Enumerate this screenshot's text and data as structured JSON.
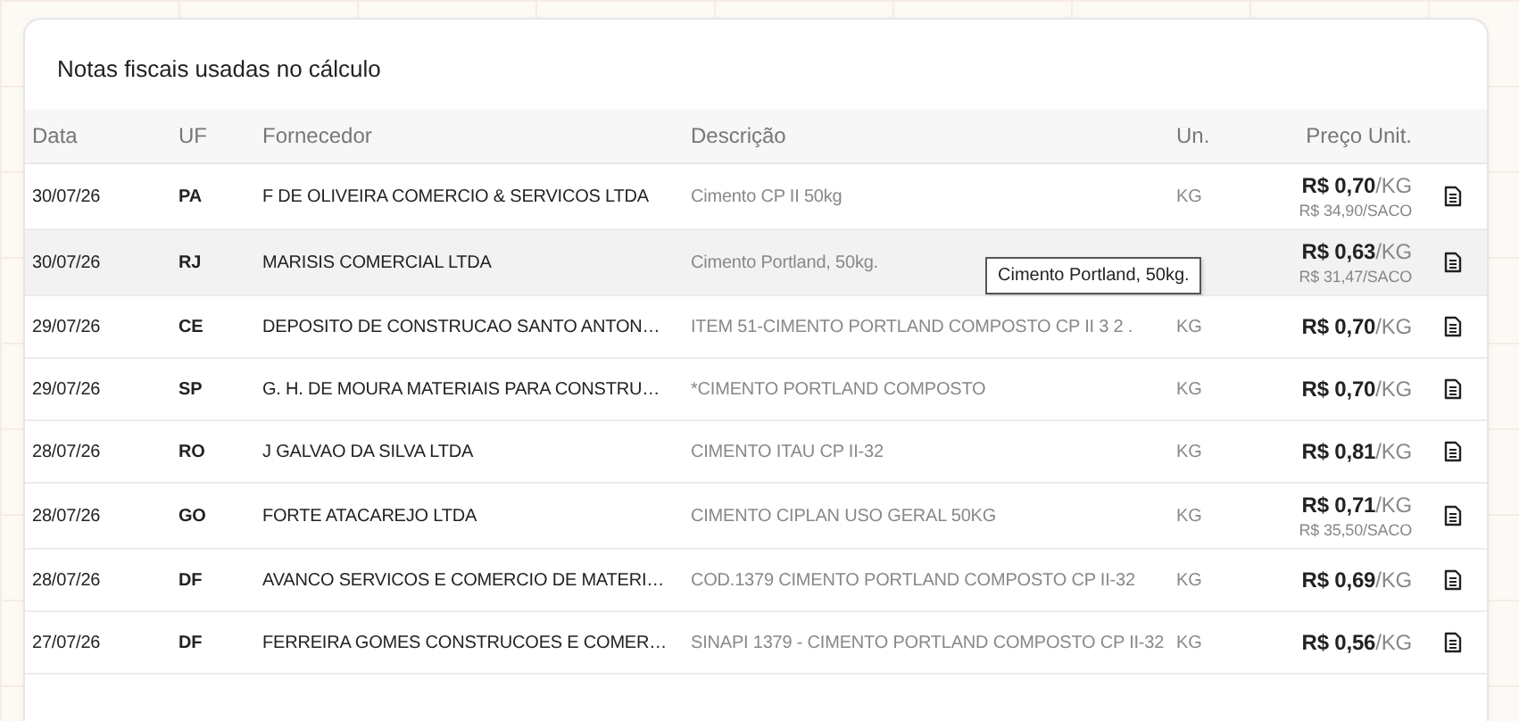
{
  "card": {
    "title": "Notas fiscais usadas no cálculo"
  },
  "table": {
    "columns": [
      "Data",
      "UF",
      "Fornecedor",
      "Descrição",
      "Un.",
      "Preço Unit."
    ],
    "rows": [
      {
        "date": "30/07/26",
        "uf": "PA",
        "supplier": "F DE OLIVEIRA COMERCIO & SERVICOS LTDA",
        "description": "Cimento CP II 50kg",
        "unit": "KG",
        "price": "**R$ 0,70**/KG",
        "price_alt": "R$ 34,90/SACO",
        "hovered": false
      },
      {
        "date": "30/07/26",
        "uf": "RJ",
        "supplier": "MARISIS COMERCIAL LTDA",
        "description": "Cimento Portland, 50kg.",
        "unit": "",
        "price": "**R$ 0,63**/KG",
        "price_alt": "R$ 31,47/SACO",
        "hovered": true,
        "tooltip": "Cimento Portland, 50kg."
      },
      {
        "date": "29/07/26",
        "uf": "CE",
        "supplier": "DEPOSITO DE CONSTRUCAO SANTO ANTON…",
        "description": "ITEM 51-CIMENTO PORTLAND COMPOSTO CP II 3 2 .",
        "unit": "KG",
        "price": "**R$ 0,70**/KG",
        "hovered": false
      },
      {
        "date": "29/07/26",
        "uf": "SP",
        "supplier": "G. H. DE MOURA MATERIAIS PARA CONSTRU…",
        "description": "*CIMENTO PORTLAND COMPOSTO",
        "unit": "KG",
        "price": "**R$ 0,70**/KG",
        "hovered": false
      },
      {
        "date": "28/07/26",
        "uf": "RO",
        "supplier": "J GALVAO DA SILVA LTDA",
        "description": "CIMENTO ITAU CP II-32",
        "unit": "KG",
        "price": "**R$ 0,81**/KG",
        "hovered": false
      },
      {
        "date": "28/07/26",
        "uf": "GO",
        "supplier": "FORTE ATACAREJO LTDA",
        "description": "CIMENTO CIPLAN USO GERAL 50KG",
        "unit": "KG",
        "price": "**R$ 0,71**/KG",
        "price_alt": "R$ 35,50/SACO",
        "hovered": false
      },
      {
        "date": "28/07/26",
        "uf": "DF",
        "supplier": "AVANCO SERVICOS E COMERCIO DE MATERI…",
        "description": "COD.1379 CIMENTO PORTLAND COMPOSTO CP II-32",
        "unit": "KG",
        "price": "**R$ 0,69**/KG",
        "hovered": false
      },
      {
        "date": "27/07/26",
        "uf": "DF",
        "supplier": "FERREIRA GOMES CONSTRUCOES E COMER…",
        "description": "SINAPI 1379 - CIMENTO PORTLAND COMPOSTO CP II-32",
        "unit": "KG",
        "price": "**R$ 0,56**/KG",
        "hovered": false
      }
    ]
  }
}
